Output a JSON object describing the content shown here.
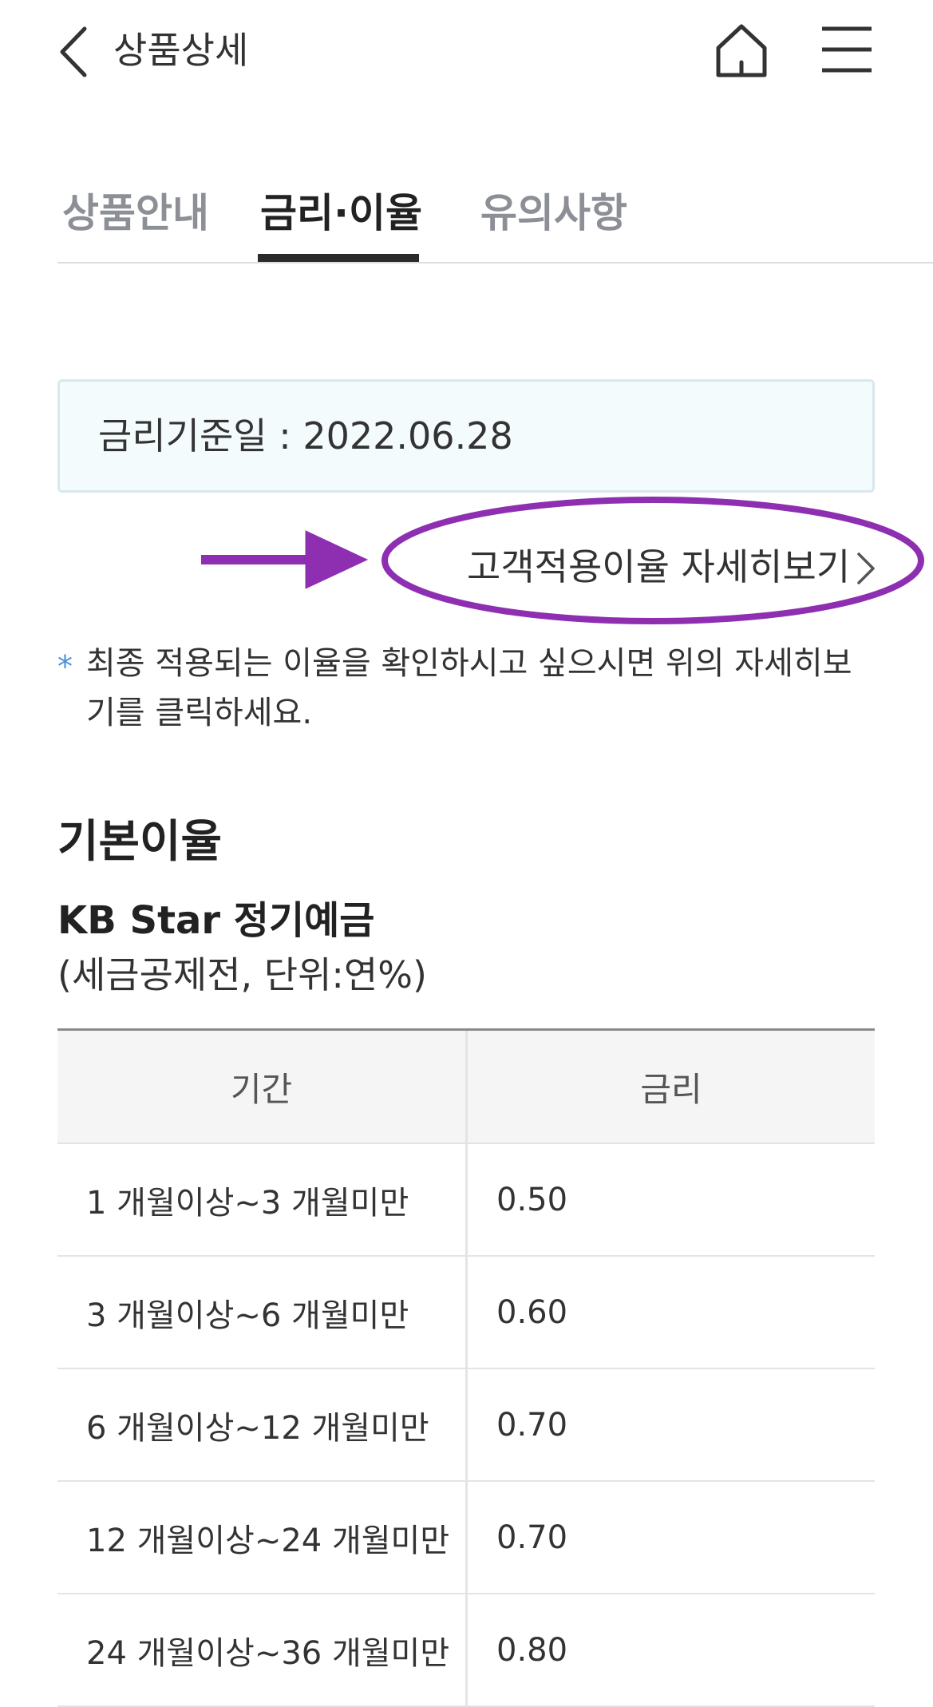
{
  "header": {
    "title": "상품상세",
    "icons": {
      "back": "chevron-left-icon",
      "home": "home-icon",
      "menu": "hamburger-menu-icon"
    }
  },
  "tabs": [
    {
      "label": "상품안내",
      "active": false
    },
    {
      "label": "금리·이율",
      "active": true
    },
    {
      "label": "유의사항",
      "active": false
    }
  ],
  "rate_info": {
    "base_date_label": "금리기준일 : 2022.06.28",
    "detail_link": "고객적용이율 자세히보기",
    "note_marker": "*",
    "note": "최종 적용되는 이율을 확인하시고 싶으시면 위의 자세히보기를 클릭하세요."
  },
  "annotation": {
    "color": "#8e2fb2"
  },
  "section": {
    "title": "기본이율",
    "product_name": "KB Star 정기예금",
    "unit_note": "(세금공제전, 단위:연%)"
  },
  "table": {
    "headers": [
      "기간",
      "금리"
    ],
    "rows": [
      [
        "1 개월이상~3 개월미만",
        "0.50"
      ],
      [
        "3 개월이상~6 개월미만",
        "0.60"
      ],
      [
        "6 개월이상~12 개월미만",
        "0.70"
      ],
      [
        "12 개월이상~24 개월미만",
        "0.70"
      ],
      [
        "24 개월이상~36 개월미만",
        "0.80"
      ]
    ]
  }
}
